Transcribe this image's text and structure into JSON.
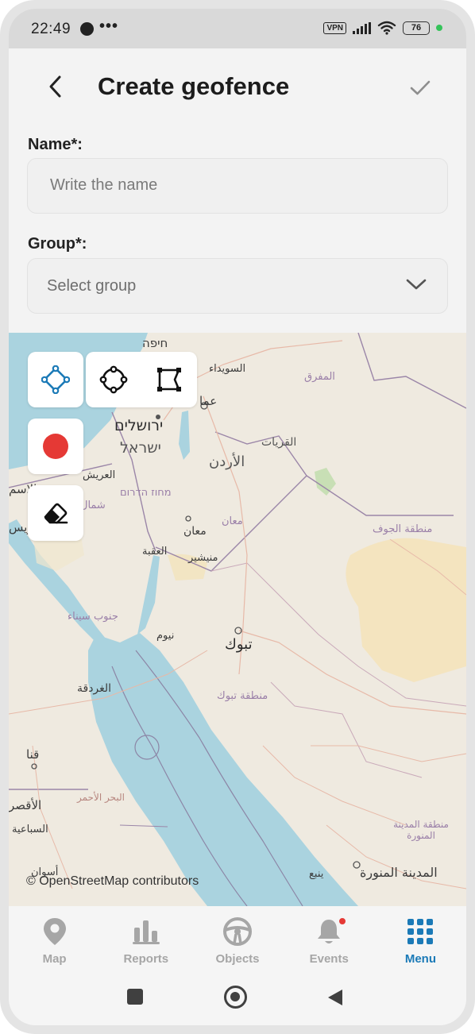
{
  "status_bar": {
    "time": "22:49",
    "dots": "•••",
    "vpn": "VPN",
    "battery": "76"
  },
  "header": {
    "title": "Create geofence",
    "back_icon": "chevron-left-icon",
    "confirm_icon": "check-icon"
  },
  "form": {
    "name_label": "Name*:",
    "name_placeholder": "Write the name",
    "name_value": "",
    "group_label": "Group*:",
    "group_placeholder": "Select group"
  },
  "map": {
    "attribution": "© OpenStreetMap contributors",
    "labels": {
      "haifa": "חיפה",
      "suwayda": "السويداء",
      "mafraq": "المفرق",
      "amman": "عما",
      "jerusalem": "ירושלים",
      "israel": "ישראל",
      "qurayyat": "القريات",
      "jordan": "الأردن",
      "arish": "العريش",
      "ismailia": "الاسم",
      "north": "شمال",
      "south_district": "מחוז הדרום",
      "suez": "ويس",
      "maan_region": "معان",
      "maan": "معان",
      "jawf_region": "منطقة الجوف",
      "aqaba": "العقبة",
      "munayshir": "منيشير",
      "south_sinai": "جنوب سيناء",
      "neom": "نيوم",
      "tabuk": "تبوك",
      "hurghada": "الغردقة",
      "tabuk_region": "منطقة تبوك",
      "qena": "قنا",
      "red_sea": "البحر الأحمر",
      "luxor": "الأقصر",
      "sabaiya": "السباعية",
      "madinah_region": "منطقة المدينة المنورة",
      "aswan": "أسوان",
      "yanbu": "ينبع",
      "madinah": "المدينة المنورة"
    },
    "tools": {
      "polygon_icon": "polygon-draw-icon",
      "circle_icon": "circle-draw-icon",
      "rectangle_icon": "rectangle-draw-icon",
      "record_icon": "record-icon",
      "eraser_icon": "eraser-icon"
    }
  },
  "bottom_nav": {
    "items": [
      {
        "label": "Map",
        "icon": "map-pin-icon"
      },
      {
        "label": "Reports",
        "icon": "bar-chart-icon"
      },
      {
        "label": "Objects",
        "icon": "steering-wheel-icon"
      },
      {
        "label": "Events",
        "icon": "bell-icon"
      },
      {
        "label": "Menu",
        "icon": "grid-icon"
      }
    ],
    "active": "Menu"
  },
  "colors": {
    "accent": "#1b7ab7",
    "record": "#e53935",
    "sea": "#aad3df",
    "land": "#efeae0",
    "inactive_nav": "#a6a6a6"
  }
}
